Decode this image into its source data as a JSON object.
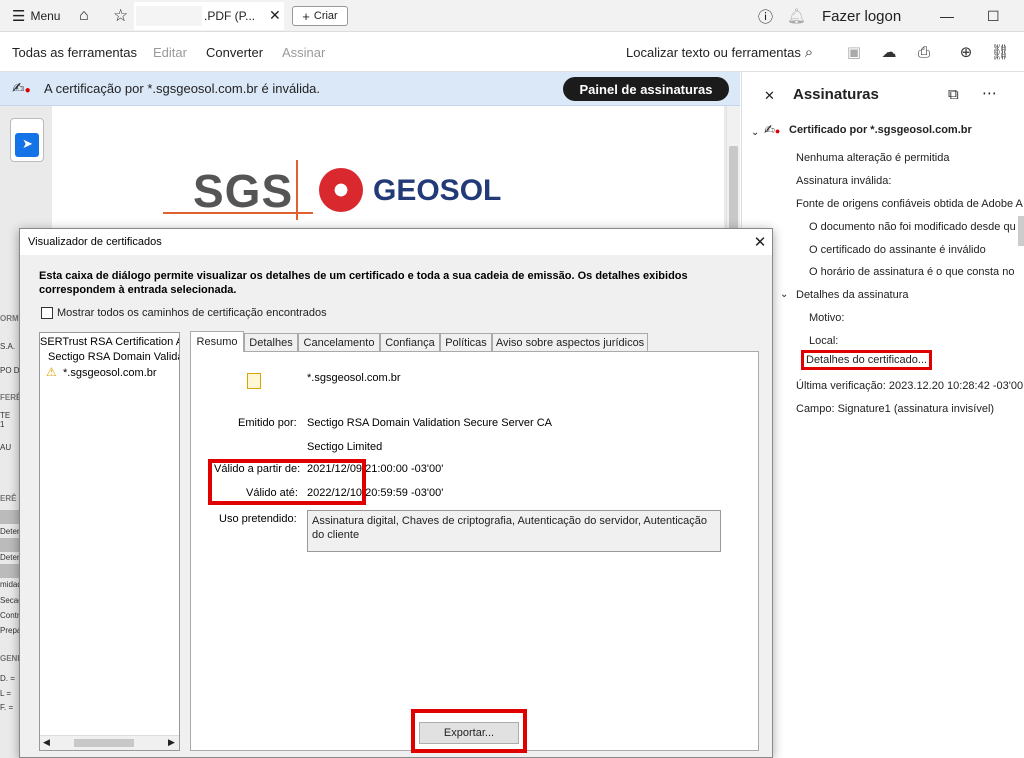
{
  "topbar": {
    "menu_label": "Menu",
    "tab_title": ".PDF (P...",
    "create_label": "Criar",
    "login_label": "Fazer logon"
  },
  "toolbar": {
    "all_tools": "Todas as ferramentas",
    "edit": "Editar",
    "convert": "Converter",
    "sign": "Assinar",
    "search_label": "Localizar texto ou ferramentas"
  },
  "banner": {
    "message": "A certificação por *.sgsgeosol.com.br é inválida.",
    "panel_button": "Painel de assinaturas"
  },
  "document": {
    "logo_left": "SGS",
    "logo_right": "GEOSOL",
    "fragments": [
      "ORM",
      "S.A.",
      "PO D",
      "FERÊ",
      "TE",
      "1",
      "AU",
      "ERÊ",
      "Deter",
      "Deter",
      "midad",
      "Secag",
      "Contr",
      "Prepar",
      "GEND",
      "D. =",
      "L =",
      "F. ="
    ]
  },
  "signatures_panel": {
    "title": "Assinaturas",
    "certified_by": "Certificado por *.sgsgeosol.com.br",
    "no_changes": "Nenhuma alteração é permitida",
    "invalid_signature": "Assinatura inválida:",
    "trusted_source": "Fonte de origens confiáveis obtida de Adobe A",
    "not_modified": "O documento não foi modificado desde qu",
    "signer_invalid": "O certificado do assinante é inválido",
    "sign_time": "O horário de assinatura é o que consta no",
    "signature_details": "Detalhes da assinatura",
    "reason": "Motivo:",
    "location": "Local:",
    "cert_details": "Detalhes do certificado...",
    "last_check": "Última verificação: 2023.12.20 10:28:42 -03'00",
    "field": "Campo: Signature1 (assinatura invisível)"
  },
  "dialog": {
    "title": "Visualizador de certificados",
    "description": "Esta caixa de diálogo permite visualizar os detalhes de um certificado e toda a sua cadeia de emissão. Os detalhes exibidos correspondem à entrada selecionada.",
    "show_all_paths": "Mostrar todos os caminhos de certificação encontrados",
    "tree": [
      "SERTrust RSA Certification A",
      "Sectigo RSA Domain Valida",
      "*.sgsgeosol.com.br"
    ],
    "tabs": [
      "Resumo",
      "Detalhes",
      "Cancelamento",
      "Confiança",
      "Políticas",
      "Aviso sobre aspectos jurídicos"
    ],
    "summary": {
      "subject": "*.sgsgeosol.com.br",
      "issued_by_label": "Emitido por:",
      "issued_by_value": "Sectigo RSA Domain Validation Secure Server CA",
      "issued_by_org": "Sectigo Limited",
      "valid_from_label": "Válido a partir de:",
      "valid_from_value": "2021/12/09 21:00:00 -03'00'",
      "valid_to_label": "Válido até:",
      "valid_to_value": "2022/12/10 20:59:59 -03'00'",
      "intended_use_label": "Uso pretendido:",
      "intended_use_value": "Assinatura digital, Chaves de criptografia, Autenticação do servidor, Autenticação do cliente"
    },
    "export_button": "Exportar..."
  }
}
